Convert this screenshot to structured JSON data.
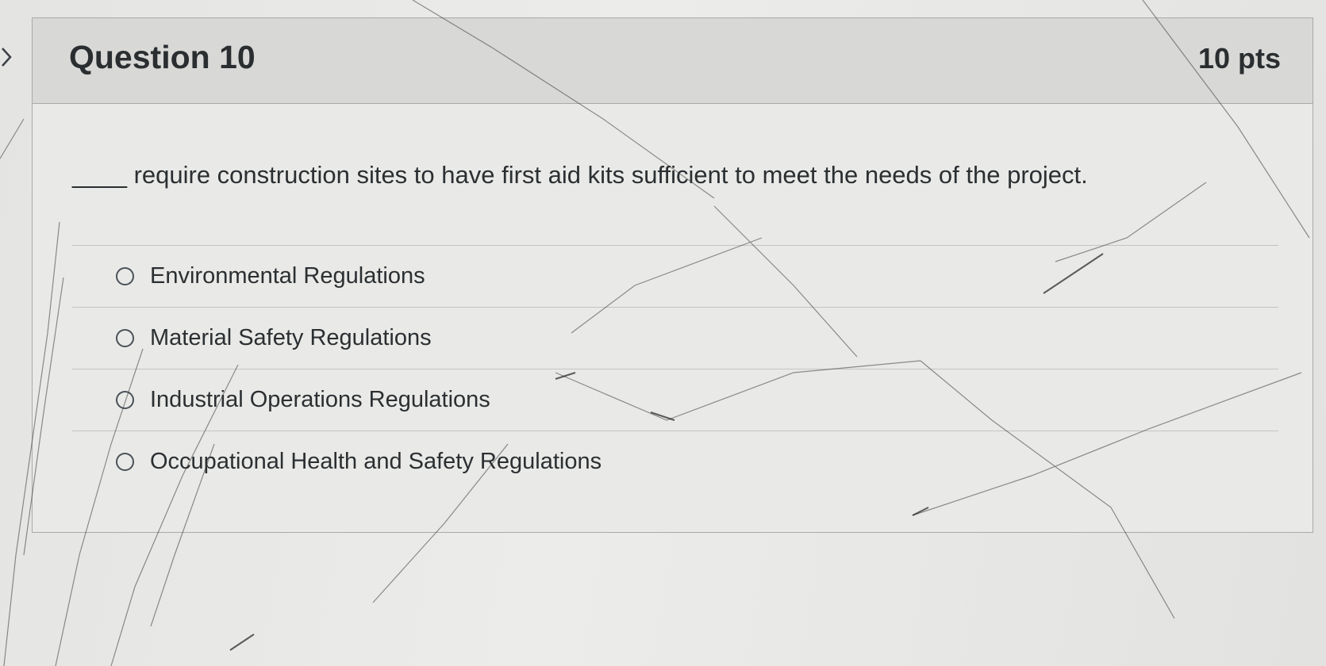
{
  "question": {
    "title": "Question 10",
    "points": "10 pts",
    "text": "____ require construction sites to have first aid kits sufficient to meet the needs of the project."
  },
  "answers": [
    {
      "label": "Environmental Regulations",
      "selected": false
    },
    {
      "label": "Material Safety Regulations",
      "selected": false
    },
    {
      "label": "Industrial Operations Regulations",
      "selected": false
    },
    {
      "label": "Occupational Health and Safety Regulations",
      "selected": false
    }
  ],
  "icons": {
    "collapse_toggle": "chevron-right-icon"
  }
}
